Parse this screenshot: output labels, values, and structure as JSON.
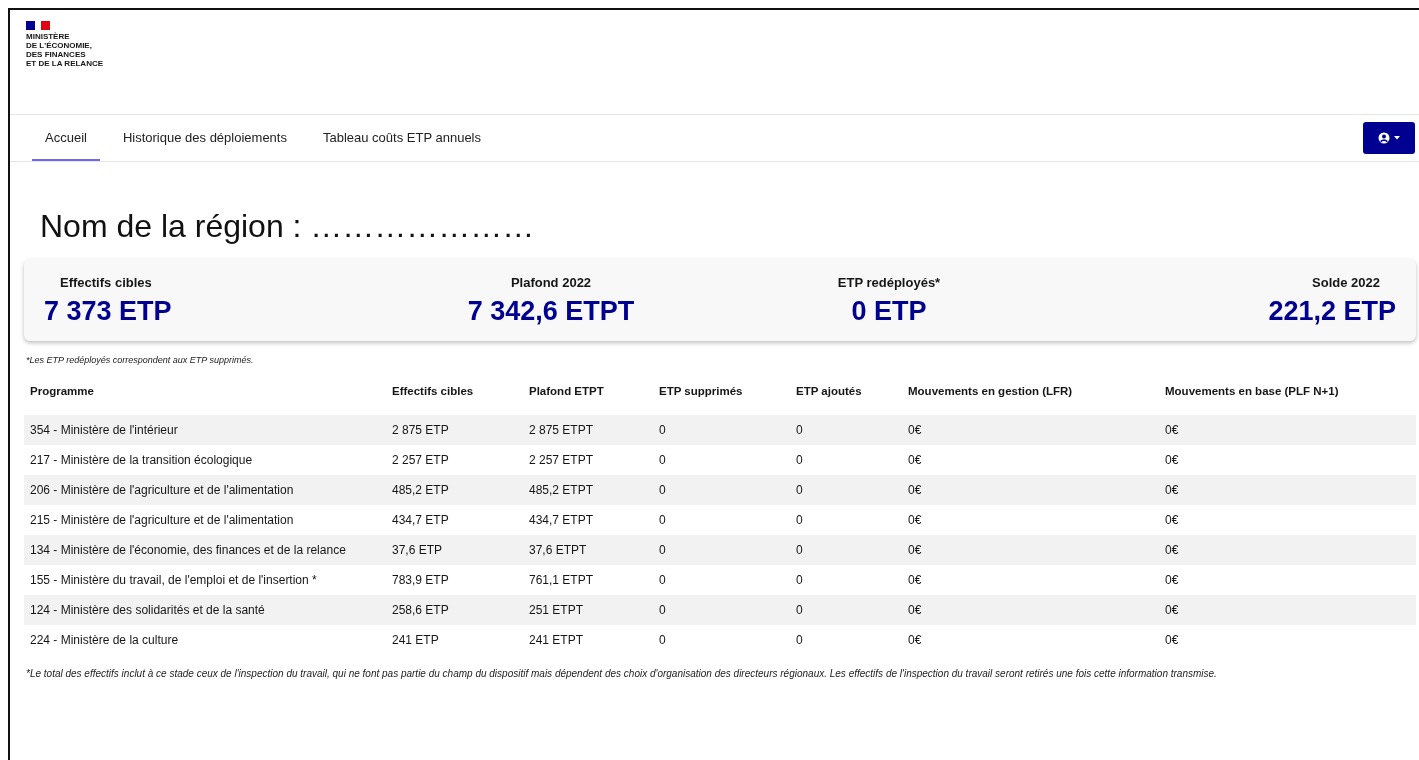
{
  "header": {
    "logo_lines": [
      "MINISTÈRE",
      "DE L'ÉCONOMIE,",
      "DES FINANCES",
      "ET DE LA RELANCE"
    ]
  },
  "tabs": [
    {
      "label": "Accueil",
      "selected": true
    },
    {
      "label": "Historique des déploiements",
      "selected": false
    },
    {
      "label": "Tableau coûts ETP annuels",
      "selected": false
    }
  ],
  "page_title": "Nom de la région : …………………",
  "summary": [
    {
      "label": "Effectifs cibles",
      "value": "7 373 ETP"
    },
    {
      "label": "Plafond 2022",
      "value": "7 342,6 ETPT"
    },
    {
      "label": "ETP redéployés*",
      "value": "0 ETP"
    },
    {
      "label": "Solde 2022",
      "value": "221,2 ETP"
    }
  ],
  "summary_note": "*Les ETP redéployés correspondent aux ETP supprimés.",
  "table": {
    "columns": [
      "Programme",
      "Effectifs cibles",
      "Plafond ETPT",
      "ETP supprimés",
      "ETP ajoutés",
      "Mouvements en gestion (LFR)",
      "Mouvements en base (PLF N+1)"
    ],
    "rows": [
      [
        "354 - Ministère de l'intérieur",
        "2 875 ETP",
        "2 875 ETPT",
        "0",
        "0",
        "0€",
        "0€"
      ],
      [
        "217 - Ministère de la transition écologique",
        "2 257 ETP",
        "2 257 ETPT",
        "0",
        "0",
        "0€",
        "0€"
      ],
      [
        "206 - Ministère de l'agriculture et de l'alimentation",
        "485,2 ETP",
        "485,2 ETPT",
        "0",
        "0",
        "0€",
        "0€"
      ],
      [
        "215 - Ministère de l'agriculture et de l'alimentation",
        "434,7 ETP",
        "434,7 ETPT",
        "0",
        "0",
        "0€",
        "0€"
      ],
      [
        "134 - Ministère de l'économie, des finances et de la relance",
        "37,6 ETP",
        "37,6 ETPT",
        "0",
        "0",
        "0€",
        "0€"
      ],
      [
        "155 - Ministère du travail, de l'emploi et de l'insertion *",
        "783,9 ETP",
        "761,1 ETPT",
        "0",
        "0",
        "0€",
        "0€"
      ],
      [
        "124 - Ministère des solidarités et de la santé",
        "258,6 ETP",
        "251 ETPT",
        "0",
        "0",
        "0€",
        "0€"
      ],
      [
        "224 - Ministère de la culture",
        "241 ETP",
        "241 ETPT",
        "0",
        "0",
        "0€",
        "0€"
      ]
    ]
  },
  "table_note": "*Le total des effectifs inclut à ce stade ceux de l'inspection du travail, qui ne font pas partie du champ du dispositif mais dépendent des choix d'organisation des directeurs régionaux. Les effectifs de l'inspection du travail seront retirés une fois cette information transmise."
}
